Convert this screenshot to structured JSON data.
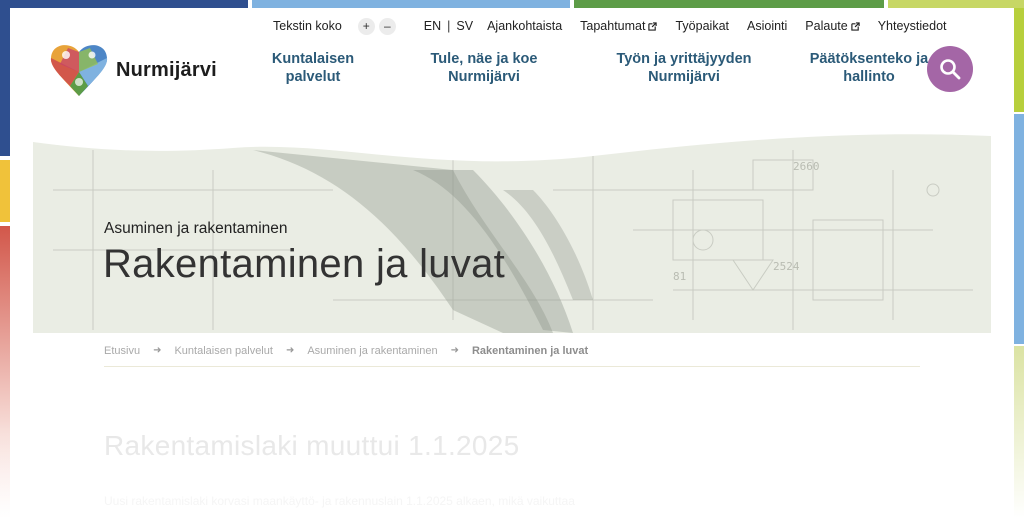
{
  "colors": {
    "nav_text": "#2b5a78",
    "search_button": "#a466a6",
    "accent_blue": "#2f4f8f",
    "accent_green": "#5d9c47",
    "accent_yellow": "#f0c23a",
    "accent_red": "#d2574a"
  },
  "utility": {
    "text_size_label": "Tekstin koko",
    "increase": "+",
    "decrease": "–",
    "lang_en": "EN",
    "lang_separator": "|",
    "lang_sv": "SV",
    "links": [
      {
        "label": "Ajankohtaista",
        "external": false
      },
      {
        "label": "Tapahtumat",
        "external": true
      },
      {
        "label": "Työpaikat",
        "external": false
      },
      {
        "label": "Asiointi",
        "external": false
      },
      {
        "label": "Palaute",
        "external": true
      },
      {
        "label": "Yhteystiedot",
        "external": false
      }
    ]
  },
  "logo": {
    "name": "Nurmijärvi",
    "icon": "heart-logo-icon"
  },
  "main_nav": [
    {
      "line1": "Kuntalaisen",
      "line2": "palvelut"
    },
    {
      "line1": "Tule, näe ja koe",
      "line2": "Nurmijärvi"
    },
    {
      "line1": "Työn ja yrittäjyyden",
      "line2": "Nurmijärvi"
    },
    {
      "line1": "Päätöksenteko ja",
      "line2": "hallinto"
    }
  ],
  "search": {
    "icon": "search-icon"
  },
  "hero": {
    "subtitle": "Asuminen ja rakentaminen",
    "title": "Rakentaminen ja luvat"
  },
  "breadcrumb": {
    "items": [
      "Etusivu",
      "Kuntalaisen palvelut",
      "Asuminen ja rakentaminen"
    ],
    "current": "Rakentaminen ja luvat",
    "separator": "➜"
  },
  "content": {
    "heading": "Rakentamislaki muuttui 1.1.2025",
    "body": "Uusi rakentamislaki korvasi maankäyttö- ja rakennuslain 1.1.2025 alkaen, mikä vaikuttaa"
  }
}
